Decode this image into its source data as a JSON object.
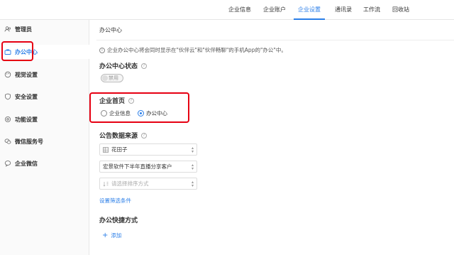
{
  "topbar": {
    "tabs": [
      {
        "label": "企业信息"
      },
      {
        "label": "企业账户"
      },
      {
        "label": "企业设置",
        "active": true
      },
      {
        "label": "通讯录"
      },
      {
        "label": "工作流"
      },
      {
        "label": "回收站"
      }
    ]
  },
  "sidebar": {
    "items": [
      {
        "label": "管理员",
        "icon": "users-icon"
      },
      {
        "label": "办公中心",
        "icon": "briefcase-icon",
        "active": true
      },
      {
        "label": "视觉设置",
        "icon": "palette-icon"
      },
      {
        "label": "安全设置",
        "icon": "shield-icon"
      },
      {
        "label": "功能设置",
        "icon": "gear-icon"
      },
      {
        "label": "微信服务号",
        "icon": "wechat-icon"
      },
      {
        "label": "企业微信",
        "icon": "wecom-icon"
      }
    ]
  },
  "main": {
    "title": "办公中心",
    "info_text": "企业办公中心将会同时显示在\"伙伴云\"和\"伙伴畅聊\"的手机App的\"办公\"中。",
    "status_section": {
      "title": "办公中心状态",
      "toggle_label": "禁用"
    },
    "home_section": {
      "title": "企业首页",
      "options": [
        {
          "label": "企业信息",
          "checked": false
        },
        {
          "label": "办公中心",
          "checked": true
        }
      ]
    },
    "data_source_section": {
      "title": "公告数据来源",
      "selects": [
        {
          "value": "花田子",
          "icon": "table-icon"
        },
        {
          "value": "宏景软件下半年直播分享客户",
          "icon": "none"
        },
        {
          "placeholder": "请选择排序方式",
          "icon": "sort-icon"
        }
      ],
      "filter_link": "设置筛选条件"
    },
    "shortcut_section": {
      "title": "办公快捷方式",
      "add_label": "添加"
    }
  },
  "colors": {
    "accent": "#2a7ee8",
    "highlight": "#e60012"
  }
}
